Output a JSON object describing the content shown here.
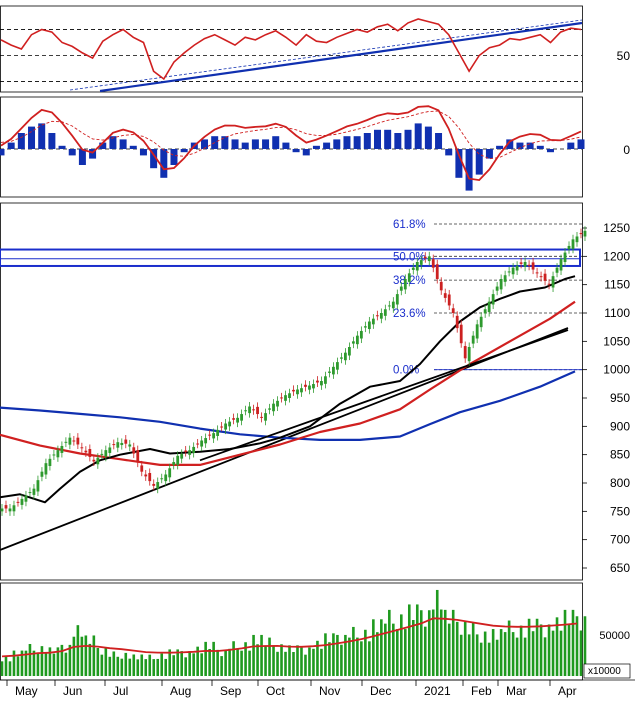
{
  "colors": {
    "price_up": "#2e9a2e",
    "price_down": "#cc2020",
    "ma_blue": "#1030b0",
    "ma_red": "#d02020",
    "ma_black": "#000000",
    "fib": "#1a2ecc",
    "volume": "#1f9a1f",
    "grid": "#333333"
  },
  "chart_data": [
    {
      "type": "line",
      "panel": "RSI",
      "yticks": [
        50
      ],
      "reference_levels": [
        70,
        50,
        30
      ],
      "series": [
        {
          "values": [
            62,
            58,
            55,
            66,
            70,
            68,
            60,
            57,
            52,
            48,
            61,
            66,
            70,
            64,
            60,
            38,
            32,
            45,
            52,
            58,
            63,
            66,
            62,
            58,
            64,
            62,
            66,
            69,
            64,
            58,
            66,
            61,
            60,
            64,
            67,
            70,
            68,
            72,
            74,
            69,
            75,
            78,
            76,
            74,
            66,
            52,
            38,
            50,
            56,
            58,
            63,
            62,
            64,
            66,
            60,
            68,
            71,
            70
          ]
        }
      ]
    },
    {
      "type": "bar",
      "panel": "MACD",
      "yticks": [
        0
      ],
      "series": [
        {
          "values": [
            -2,
            2,
            5,
            7,
            8,
            5,
            1,
            -2,
            -5,
            -3,
            2,
            4,
            3,
            1,
            -2,
            -6,
            -9,
            -5,
            -1,
            2,
            3,
            4,
            4,
            3,
            2,
            3,
            3,
            4,
            2,
            -1,
            -2,
            1,
            2,
            3,
            4,
            4,
            5,
            6,
            6,
            5,
            6,
            8,
            7,
            5,
            -2,
            -9,
            -13,
            -8,
            -3,
            1,
            3,
            2,
            2,
            1,
            -1,
            0,
            2,
            3
          ]
        }
      ]
    },
    {
      "type": "line",
      "panel": "Price",
      "x": [
        "May",
        "Jun",
        "Jul",
        "Aug",
        "Sep",
        "Oct",
        "Nov",
        "Dec",
        "2021",
        "Feb",
        "Mar",
        "Apr"
      ],
      "yticks": [
        650,
        700,
        750,
        800,
        850,
        900,
        950,
        1000,
        1050,
        1100,
        1150,
        1200,
        1250
      ],
      "fibonacci": [
        {
          "label": "61.8%",
          "value": 1257
        },
        {
          "label": "50.0%",
          "value": 1200
        },
        {
          "label": "38.2%",
          "value": 1158
        },
        {
          "label": "23.6%",
          "value": 1100
        },
        {
          "label": "0.0%",
          "value": 1000
        }
      ],
      "resistance_zone": [
        1183,
        1212
      ],
      "series": [
        {
          "values": [
            755,
            772,
            790,
            835,
            858,
            880,
            862,
            838,
            858,
            872,
            868,
            820,
            795,
            815,
            848,
            858,
            875,
            888,
            905,
            915,
            935,
            915,
            940,
            955,
            965,
            972,
            980,
            1005,
            1030,
            1060,
            1085,
            1100,
            1120,
            1160,
            1190,
            1200,
            1140,
            1100,
            1020,
            1080,
            1120,
            1160,
            1180,
            1190,
            1170,
            1150,
            1195,
            1230,
            1245
          ]
        }
      ]
    },
    {
      "type": "bar",
      "panel": "Volume",
      "unit_label": "x10000",
      "yticks": [
        50000
      ],
      "series": [
        {
          "values": [
            22000,
            26000,
            30000,
            32000,
            28000,
            35000,
            52000,
            38000,
            30000,
            24000,
            26000,
            22000,
            20000,
            24000,
            26000,
            28000,
            30000,
            32000,
            28000,
            34000,
            38000,
            42000,
            36000,
            34000,
            30000,
            32000,
            36000,
            40000,
            44000,
            48000,
            52000,
            58000,
            62000,
            66000,
            70000,
            74000,
            88000,
            62000,
            58000,
            52000,
            50000,
            48000,
            52000,
            54000,
            56000,
            58000,
            60000,
            62000,
            64000
          ]
        }
      ]
    }
  ],
  "axis": {
    "months": [
      "May",
      "Jun",
      "Jul",
      "Aug",
      "Sep",
      "Oct",
      "Nov",
      "Dec",
      "2021",
      "Feb",
      "Mar",
      "Apr"
    ],
    "rsi_tick": "50",
    "macd_tick": "0",
    "price_ticks": [
      "1250",
      "1200",
      "1150",
      "1100",
      "1050",
      "1000",
      "950",
      "900",
      "850",
      "800",
      "750",
      "700",
      "650"
    ],
    "volume_tick": "50000",
    "volume_unit": "x10000"
  }
}
